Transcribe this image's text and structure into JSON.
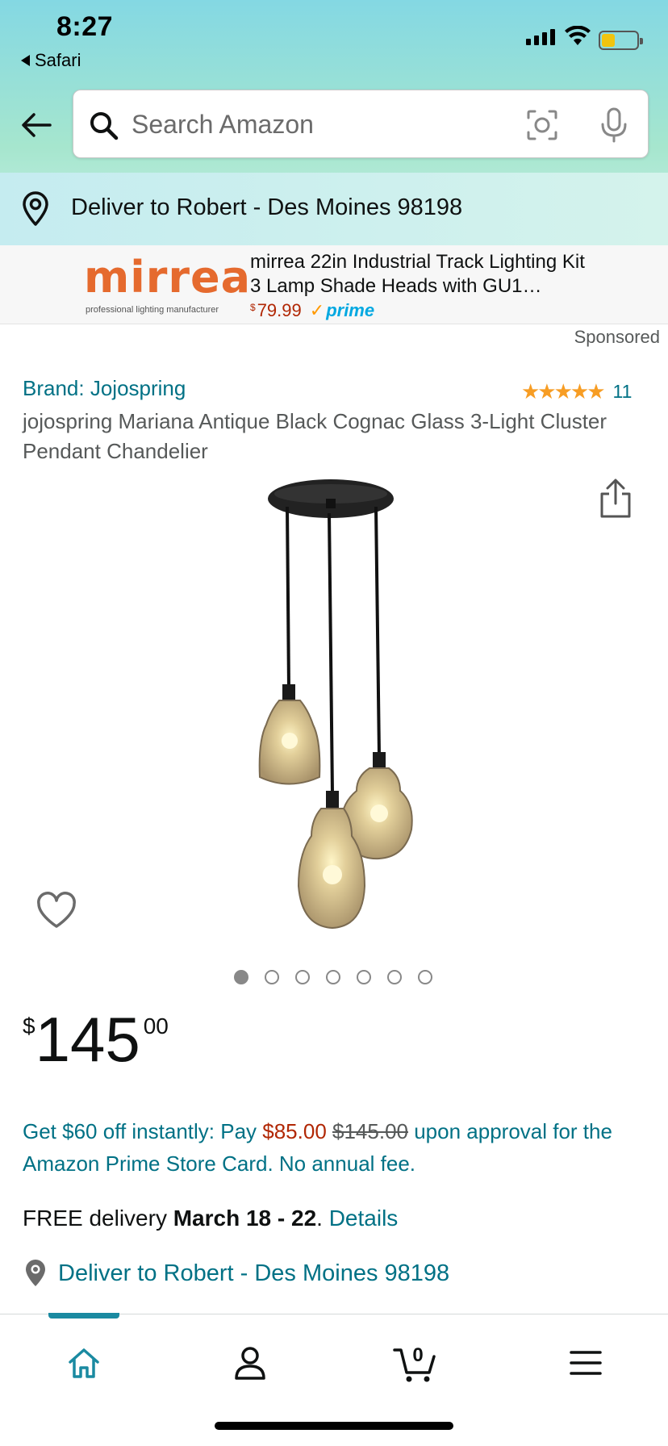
{
  "status_bar": {
    "time": "8:27",
    "back_app": "Safari"
  },
  "header": {
    "search_placeholder": "Search Amazon",
    "deliver_to": "Deliver to Robert - Des Moines 98198",
    "icons": [
      "back-arrow-icon",
      "search-icon",
      "camera-icon",
      "microphone-icon",
      "location-pin-icon"
    ]
  },
  "sponsored_ad": {
    "logo_text": "mirrea",
    "logo_tagline": "professional lighting manufacturer",
    "title": "mirrea 22in Industrial Track Lighting Kit 3 Lamp Shade Heads with GU1…",
    "price_currency": "$",
    "price": "79.99",
    "prime_label": "prime",
    "sponsored_label": "Sponsored"
  },
  "product": {
    "brand": "Brand: Jojospring",
    "rating_stars": "★★★★★",
    "rating_count": "11",
    "title": "jojospring Mariana Antique Black Cognac Glass 3-Light Cluster Pendant Chandelier",
    "image_count": 7,
    "active_image_index": 0,
    "price_currency": "$",
    "price_whole": "145",
    "price_fraction": "00"
  },
  "offer": {
    "prefix": "Get $60 off instantly: Pay ",
    "discounted_price": "$85.00",
    "space": " ",
    "original_price": "$145.00",
    "suffix": " upon approval for the Amazon Prime Store Card. No annual fee."
  },
  "delivery": {
    "prefix": "FREE delivery ",
    "dates": "March 18 - 22",
    "separator": ". ",
    "details_link": "Details",
    "deliver_to": "Deliver to Robert - Des Moines 98198"
  },
  "bottom_nav": {
    "items": [
      "home-icon",
      "account-icon",
      "cart-icon",
      "menu-icon"
    ],
    "cart_count": "0",
    "active_item": "home-icon"
  },
  "colors": {
    "link_teal": "#007185",
    "price_red": "#b12704",
    "star_orange": "#f79d24",
    "header_gradient_start": "#84d8e3",
    "header_gradient_end": "#a6e6ce",
    "ad_logo_orange": "#e56a2e"
  }
}
